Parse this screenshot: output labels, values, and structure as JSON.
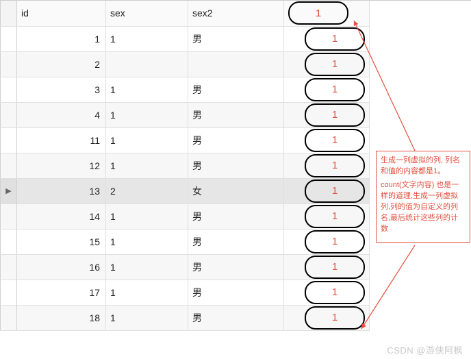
{
  "columns": {
    "id": "id",
    "sex": "sex",
    "sex2": "sex2",
    "one": "1"
  },
  "rows": [
    {
      "id": "1",
      "sex": "1",
      "sex2": "男",
      "one": "1",
      "active": false
    },
    {
      "id": "2",
      "sex": "",
      "sex2": "",
      "one": "1",
      "active": false
    },
    {
      "id": "3",
      "sex": "1",
      "sex2": "男",
      "one": "1",
      "active": false
    },
    {
      "id": "4",
      "sex": "1",
      "sex2": "男",
      "one": "1",
      "active": false
    },
    {
      "id": "11",
      "sex": "1",
      "sex2": "男",
      "one": "1",
      "active": false
    },
    {
      "id": "12",
      "sex": "1",
      "sex2": "男",
      "one": "1",
      "active": false
    },
    {
      "id": "13",
      "sex": "2",
      "sex2": "女",
      "one": "1",
      "active": true
    },
    {
      "id": "14",
      "sex": "1",
      "sex2": "男",
      "one": "1",
      "active": false
    },
    {
      "id": "15",
      "sex": "1",
      "sex2": "男",
      "one": "1",
      "active": false
    },
    {
      "id": "16",
      "sex": "1",
      "sex2": "男",
      "one": "1",
      "active": false
    },
    {
      "id": "17",
      "sex": "1",
      "sex2": "男",
      "one": "1",
      "active": false
    },
    {
      "id": "18",
      "sex": "1",
      "sex2": "男",
      "one": "1",
      "active": false
    }
  ],
  "active_marker": "▶",
  "annotation": {
    "p1": "生成一列虚拟的列, 列名和值的内容都是1。",
    "p2": "count(文字内容) 也是一样的道理,生成一列虚拟列,列的值为自定义的列名,最后统计这些列的计数"
  },
  "watermark": "CSDN @游侠阿枫"
}
